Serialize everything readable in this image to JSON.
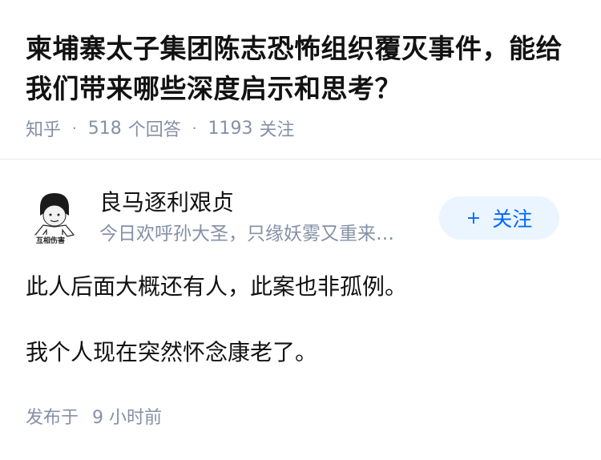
{
  "question": {
    "title": "柬埔寨太子集团陈志恐怖组织覆灭事件，能给我们带来哪些深度启示和思考？",
    "source": "知乎",
    "answer_count": "518",
    "answer_label": "个回答",
    "follower_count": "1193",
    "follower_label": "关注"
  },
  "answer": {
    "author_name": "良马逐利艰贞",
    "author_bio": "今日欢呼孙大圣，只缘妖雾又重来…",
    "avatar_caption": "互相伤害",
    "follow_label": "关注",
    "follow_icon": "plus-icon",
    "paragraphs": [
      "此人后面大概还有人，此案也非孤例。",
      "我个人现在突然怀念康老了。"
    ],
    "posted_label": "发布于",
    "posted_time": "9 小时前"
  },
  "colors": {
    "meta_gray": "#8590a6",
    "accent_blue": "#0066ff",
    "follow_bg": "#ebf5ff",
    "divider": "#ebebeb"
  }
}
